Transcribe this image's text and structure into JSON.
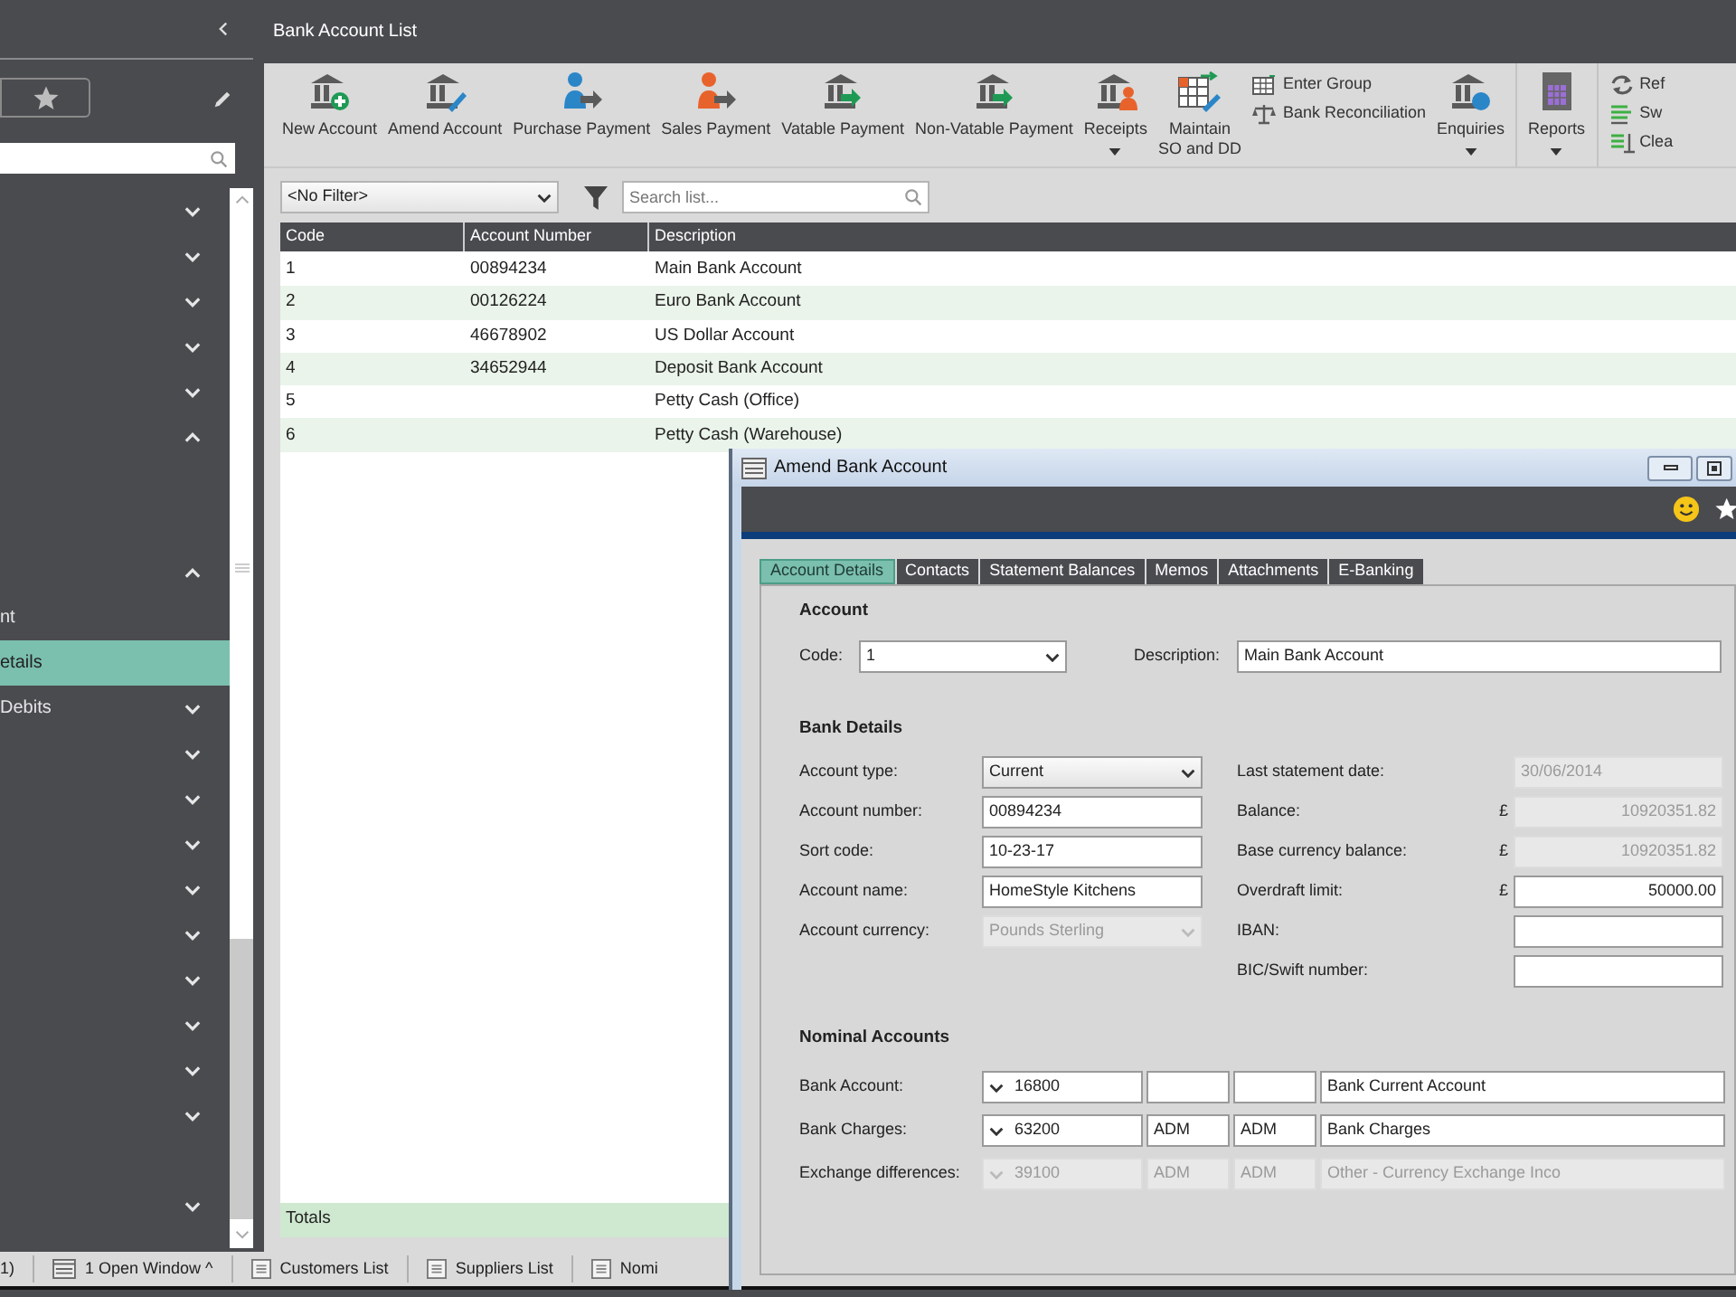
{
  "sidebar": {
    "items": [
      {
        "kind": "group",
        "expanded": false,
        "selected": false
      },
      {
        "kind": "group",
        "expanded": false,
        "selected": false
      },
      {
        "kind": "group",
        "expanded": false,
        "selected": false
      },
      {
        "kind": "group",
        "expanded": false,
        "selected": false
      },
      {
        "kind": "group",
        "expanded": false,
        "selected": false
      },
      {
        "kind": "group",
        "expanded": true,
        "selected": false
      },
      {
        "kind": "spacer"
      },
      {
        "kind": "spacer"
      },
      {
        "kind": "group",
        "expanded": true,
        "selected": false
      },
      {
        "kind": "item",
        "label": "nt",
        "selected": false
      },
      {
        "kind": "item",
        "label": "etails",
        "selected": true
      },
      {
        "kind": "group",
        "label": "Debits",
        "expanded": false,
        "selected": false
      },
      {
        "kind": "group",
        "expanded": false,
        "selected": false
      },
      {
        "kind": "group",
        "expanded": false,
        "selected": false
      },
      {
        "kind": "group",
        "expanded": false,
        "selected": false
      },
      {
        "kind": "group",
        "expanded": false,
        "selected": false
      },
      {
        "kind": "group",
        "expanded": false,
        "selected": false
      },
      {
        "kind": "group",
        "expanded": false,
        "selected": false
      },
      {
        "kind": "group",
        "expanded": false,
        "selected": false
      },
      {
        "kind": "group",
        "expanded": false,
        "selected": false
      },
      {
        "kind": "group",
        "expanded": false,
        "selected": false
      },
      {
        "kind": "spacer"
      },
      {
        "kind": "group",
        "expanded": false,
        "selected": false
      }
    ]
  },
  "main": {
    "title": "Bank Account List",
    "toolbar": [
      {
        "kind": "large",
        "label": "New Account",
        "has_menu": false
      },
      {
        "kind": "large",
        "label": "Amend Account",
        "has_menu": false
      },
      {
        "kind": "large",
        "label": "Purchase Payment",
        "has_menu": false
      },
      {
        "kind": "large",
        "label": "Sales Payment",
        "has_menu": false
      },
      {
        "kind": "large",
        "label": "Vatable Payment",
        "has_menu": false
      },
      {
        "kind": "large",
        "label": "Non-Vatable Payment",
        "has_menu": false
      },
      {
        "kind": "large",
        "label": "Receipts",
        "has_menu": true
      },
      {
        "kind": "large",
        "label": "Maintain\nSO and DD",
        "has_menu": false
      },
      {
        "kind": "stack",
        "items": [
          "Enter Group",
          "Bank Reconciliation"
        ]
      },
      {
        "kind": "large",
        "label": "Enquiries",
        "has_menu": true
      },
      {
        "kind": "separator"
      },
      {
        "kind": "large",
        "label": "Reports",
        "has_menu": true
      },
      {
        "kind": "separator"
      },
      {
        "kind": "stack",
        "items": [
          "Ref",
          "Sw",
          "Clea"
        ]
      }
    ],
    "filter": {
      "value": "<No Filter>"
    },
    "search": {
      "placeholder": "Search list..."
    },
    "table": {
      "columns": [
        "Code",
        "Account Number",
        "Description"
      ],
      "rows": [
        [
          "1",
          "00894234",
          "Main Bank Account"
        ],
        [
          "2",
          "00126224",
          "Euro Bank Account"
        ],
        [
          "3",
          "46678902",
          "US Dollar Account"
        ],
        [
          "4",
          "34652944",
          "Deposit Bank Account"
        ],
        [
          "5",
          "",
          "Petty Cash (Office)"
        ],
        [
          "6",
          "",
          "Petty Cash (Warehouse)"
        ]
      ],
      "totals_label": "Totals"
    }
  },
  "dialog": {
    "title": "Amend Bank Account",
    "tabs": [
      {
        "label": "Account Details",
        "selected": true
      },
      {
        "label": "Contacts",
        "selected": false
      },
      {
        "label": "Statement Balances",
        "selected": false
      },
      {
        "label": "Memos",
        "selected": false
      },
      {
        "label": "Attachments",
        "selected": false
      },
      {
        "label": "E-Banking",
        "selected": false
      }
    ],
    "account": {
      "heading": "Account",
      "code_label": "Code:",
      "code_value": "1",
      "description_label": "Description:",
      "description_value": "Main Bank Account"
    },
    "bank_details": {
      "heading": "Bank Details",
      "left": [
        {
          "label": "Account type:",
          "kind": "select",
          "value": "Current",
          "disabled": false
        },
        {
          "label": "Account number:",
          "kind": "input",
          "value": "00894234",
          "disabled": false
        },
        {
          "label": "Sort code:",
          "kind": "input",
          "value": "10-23-17",
          "disabled": false
        },
        {
          "label": "Account name:",
          "kind": "input",
          "value": "HomeStyle Kitchens",
          "disabled": false
        },
        {
          "label": "Account currency:",
          "kind": "select",
          "value": "Pounds Sterling",
          "disabled": true
        }
      ],
      "right": [
        {
          "label": "Last statement date:",
          "value": "30/06/2014",
          "disabled": true
        },
        {
          "label": "Balance:",
          "currency": "£",
          "value": "10920351.82",
          "disabled": true
        },
        {
          "label": "Base currency balance:",
          "currency": "£",
          "value": "10920351.82",
          "disabled": true
        },
        {
          "label": "Overdraft limit:",
          "currency": "£",
          "value": "50000.00",
          "disabled": false
        },
        {
          "label": "IBAN:",
          "disabled": false
        },
        {
          "label": "BIC/Swift number:",
          "disabled": false
        }
      ]
    },
    "nominal": {
      "heading": "Nominal Accounts",
      "rows": [
        {
          "label": "Bank Account:",
          "code": "16800",
          "name": "Bank Current Account",
          "disabled": false
        },
        {
          "label": "Bank Charges:",
          "code": "63200",
          "column_2": "ADM",
          "column_3": "ADM",
          "name": "Bank Charges",
          "disabled": false
        },
        {
          "label": "Exchange differences:",
          "code": "39100",
          "column_2": "ADM",
          "column_3": "ADM",
          "name": "Other - Currency Exchange Inco",
          "disabled": true
        }
      ]
    }
  },
  "taskbar": {
    "items": [
      {
        "label": "1)"
      },
      {
        "label": "1 Open Window ^"
      },
      {
        "label": "Customers List"
      },
      {
        "label": "Suppliers List"
      },
      {
        "label": "Nomi"
      }
    ]
  }
}
